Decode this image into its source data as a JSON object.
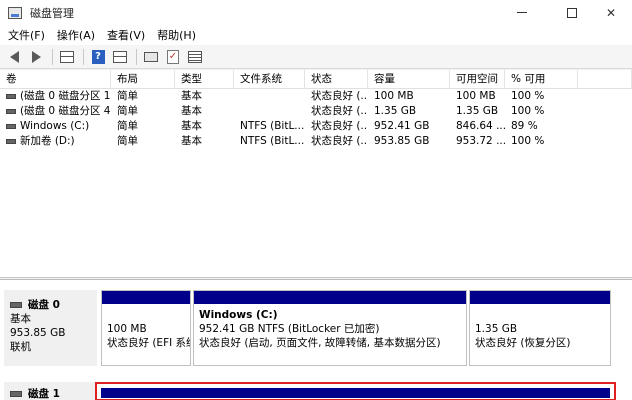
{
  "window": {
    "title": "磁盘管理"
  },
  "menu": [
    "文件(F)",
    "操作(A)",
    "查看(V)",
    "帮助(H)"
  ],
  "volume_list": {
    "columns": [
      "卷",
      "布局",
      "类型",
      "文件系统",
      "状态",
      "容量",
      "可用空间",
      "% 可用"
    ],
    "rows": [
      [
        "(磁盘 0 磁盘分区 1)",
        "简单",
        "基本",
        "",
        "状态良好 (...",
        "100 MB",
        "100 MB",
        "100 %"
      ],
      [
        "(磁盘 0 磁盘分区 4)",
        "简单",
        "基本",
        "",
        "状态良好 (...",
        "1.35 GB",
        "1.35 GB",
        "100 %"
      ],
      [
        "Windows (C:)",
        "简单",
        "基本",
        "NTFS (BitL...",
        "状态良好 (...",
        "952.41 GB",
        "846.64 ...",
        "89 %"
      ],
      [
        "新加卷 (D:)",
        "简单",
        "基本",
        "NTFS (BitL...",
        "状态良好 (...",
        "953.85 GB",
        "953.72 ...",
        "100 %"
      ]
    ]
  },
  "disks": [
    {
      "name": "磁盘 0",
      "type": "基本",
      "size": "953.85 GB",
      "status": "联机",
      "partitions": [
        {
          "title": "",
          "line1": "100 MB",
          "line2": "状态良好 (EFI 系统"
        },
        {
          "title": "Windows  (C:)",
          "line1": "952.41 GB NTFS (BitLocker 已加密)",
          "line2": "状态良好 (启动, 页面文件, 故障转储, 基本数据分区)"
        },
        {
          "title": "",
          "line1": "1.35 GB",
          "line2": "状态良好 (恢复分区)"
        }
      ]
    },
    {
      "name": "磁盘 1"
    }
  ]
}
